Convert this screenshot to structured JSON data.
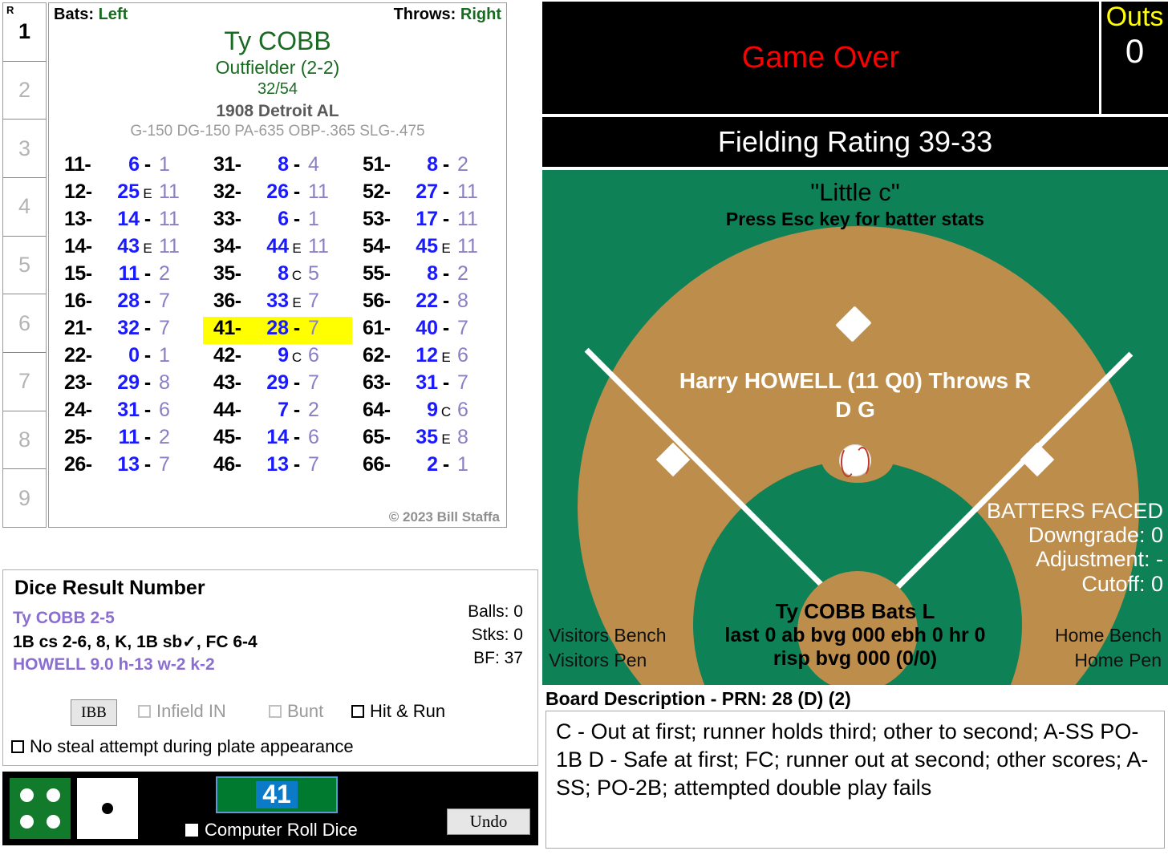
{
  "lineup": {
    "header": "R",
    "slots": [
      "1",
      "2",
      "3",
      "4",
      "5",
      "6",
      "7",
      "8",
      "9"
    ],
    "active_index": 0
  },
  "player_card": {
    "bats_label": "Bats:",
    "bats_value": "Left",
    "throws_label": "Throws:",
    "throws_value": "Right",
    "name": "Ty COBB",
    "position": "Outfielder (2-2)",
    "fraction": "32/54",
    "team": "1908 Detroit AL",
    "stats": "G-150 DG-150 PA-635 OBP-.365 SLG-.475",
    "copyright": "© 2023 Bill Staffa",
    "highlight_code": "41",
    "rows": [
      {
        "code": "11-",
        "num": "6",
        "sep": "-",
        "res": "1"
      },
      {
        "code": "12-",
        "num": "25",
        "sep": "E",
        "res": "11"
      },
      {
        "code": "13-",
        "num": "14",
        "sep": "-",
        "res": "11"
      },
      {
        "code": "14-",
        "num": "43",
        "sep": "E",
        "res": "11"
      },
      {
        "code": "15-",
        "num": "11",
        "sep": "-",
        "res": "2"
      },
      {
        "code": "16-",
        "num": "28",
        "sep": "-",
        "res": "7"
      },
      {
        "code": "21-",
        "num": "32",
        "sep": "-",
        "res": "7"
      },
      {
        "code": "22-",
        "num": "0",
        "sep": "-",
        "res": "1"
      },
      {
        "code": "23-",
        "num": "29",
        "sep": "-",
        "res": "8"
      },
      {
        "code": "24-",
        "num": "31",
        "sep": "-",
        "res": "6"
      },
      {
        "code": "25-",
        "num": "11",
        "sep": "-",
        "res": "2"
      },
      {
        "code": "26-",
        "num": "13",
        "sep": "-",
        "res": "7"
      },
      {
        "code": "31-",
        "num": "8",
        "sep": "-",
        "res": "4"
      },
      {
        "code": "32-",
        "num": "26",
        "sep": "-",
        "res": "11"
      },
      {
        "code": "33-",
        "num": "6",
        "sep": "-",
        "res": "1"
      },
      {
        "code": "34-",
        "num": "44",
        "sep": "E",
        "res": "11"
      },
      {
        "code": "35-",
        "num": "8",
        "sep": "C",
        "res": "5"
      },
      {
        "code": "36-",
        "num": "33",
        "sep": "E",
        "res": "7"
      },
      {
        "code": "41-",
        "num": "28",
        "sep": "-",
        "res": "7"
      },
      {
        "code": "42-",
        "num": "9",
        "sep": "C",
        "res": "6"
      },
      {
        "code": "43-",
        "num": "29",
        "sep": "-",
        "res": "7"
      },
      {
        "code": "44-",
        "num": "7",
        "sep": "-",
        "res": "2"
      },
      {
        "code": "45-",
        "num": "14",
        "sep": "-",
        "res": "6"
      },
      {
        "code": "46-",
        "num": "13",
        "sep": "-",
        "res": "7"
      },
      {
        "code": "51-",
        "num": "8",
        "sep": "-",
        "res": "2"
      },
      {
        "code": "52-",
        "num": "27",
        "sep": "-",
        "res": "11"
      },
      {
        "code": "53-",
        "num": "17",
        "sep": "-",
        "res": "11"
      },
      {
        "code": "54-",
        "num": "45",
        "sep": "E",
        "res": "11"
      },
      {
        "code": "55-",
        "num": "8",
        "sep": "-",
        "res": "2"
      },
      {
        "code": "56-",
        "num": "22",
        "sep": "-",
        "res": "8"
      },
      {
        "code": "61-",
        "num": "40",
        "sep": "-",
        "res": "7"
      },
      {
        "code": "62-",
        "num": "12",
        "sep": "E",
        "res": "6"
      },
      {
        "code": "63-",
        "num": "31",
        "sep": "-",
        "res": "7"
      },
      {
        "code": "64-",
        "num": "9",
        "sep": "C",
        "res": "6"
      },
      {
        "code": "65-",
        "num": "35",
        "sep": "E",
        "res": "8"
      },
      {
        "code": "66-",
        "num": "2",
        "sep": "-",
        "res": "1"
      }
    ]
  },
  "dice_result": {
    "title": "Dice Result Number",
    "batter_line": "Ty COBB  2-5",
    "result_line": "1B cs 2-6, 8, K, 1B sb✓, FC 6-4",
    "pitcher_line": "HOWELL  9.0  h-13  w-2  k-2",
    "balls": "Balls: 0",
    "strikes": "Stks: 0",
    "bf": "BF: 37",
    "ibb_label": "IBB",
    "infield_in_label": "Infield IN",
    "bunt_label": "Bunt",
    "hit_run_label": "Hit & Run",
    "no_steal_label": "No steal attempt during plate appearance"
  },
  "dice_bar": {
    "green_die_pips": 4,
    "white_die_pips": 1,
    "roll_value": "41",
    "computer_roll_label": "Computer Roll Dice",
    "undo_label": "Undo"
  },
  "scoreboard": {
    "message": "Game Over",
    "message_color": "#ff0000",
    "outs_label": "Outs",
    "outs_value": "0",
    "fielding_rating": "Fielding Rating 39-33"
  },
  "field": {
    "park_name": "\"Little c\"",
    "hint": "Press Esc key for batter stats",
    "pitcher": "Harry HOWELL (11 Q0) Throws R",
    "pitcher_grades": "D G",
    "batters_faced_title": "BATTERS FACED",
    "downgrade": "Downgrade: 0",
    "adjustment": "Adjustment: -",
    "cutoff": "Cutoff: 0",
    "batter": "Ty COBB Bats L",
    "batter_line2": "last 0 ab bvg 000 ebh 0 hr 0",
    "batter_line3": "risp bvg 000 (0/0)",
    "visitors_bench": "Visitors Bench",
    "visitors_pen": "Visitors Pen",
    "home_bench": "Home Bench",
    "home_pen": "Home Pen",
    "grass_color": "#0e8157",
    "dirt_color": "#bd8d4c"
  },
  "board": {
    "title": "Board Description - PRN: 28 (D) (2)",
    "text": "C - Out at first; runner holds third; other to second; A-SS PO-1B D - Safe at first; FC; runner out at second; other scores; A-SS; PO-2B; attempted double play fails"
  }
}
